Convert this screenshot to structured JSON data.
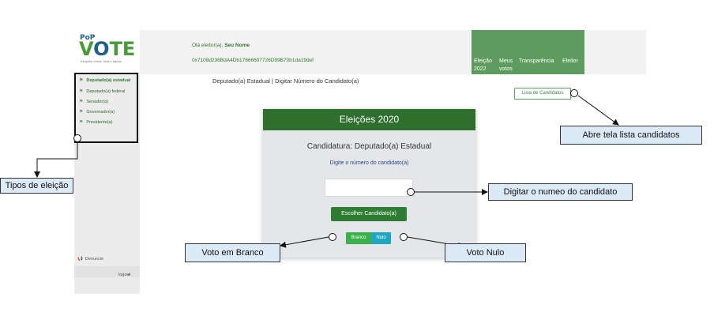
{
  "logo": {
    "pop": "PoP",
    "vote_v": "V",
    "vote_o": "O",
    "vote_te": "TE",
    "tagline": "Eleições online, fácil e rápido"
  },
  "sidebar": {
    "items": [
      {
        "label": "Deputado(a) estadual",
        "icon": "flag-icon",
        "active": true
      },
      {
        "label": "Deputado(a) federal",
        "icon": "flag-icon",
        "active": false
      },
      {
        "label": "Senador(a)",
        "icon": "flag-icon",
        "active": false
      },
      {
        "label": "Governador(a)",
        "icon": "flag-icon",
        "active": false
      },
      {
        "label": "Presidente(a)",
        "icon": "flag-icon",
        "active": false
      }
    ],
    "denuncia": "Denuncie",
    "logout": "logout"
  },
  "header": {
    "greeting": "Olá eleitor(a),",
    "user_name": "Seu Nome",
    "address": "0x7108d236BdA4Db1766660772​6D99B70b1da19def",
    "nav": [
      {
        "line1": "Eleição",
        "line2": "2022"
      },
      {
        "line1": "Meus",
        "line2": "votos"
      },
      {
        "line1": "Transparência",
        "line2": ""
      },
      {
        "line1": "Eleitor",
        "line2": ""
      }
    ]
  },
  "breadcrumb": "Deputado(a) Estadual | Digitar Número do Candidato(a)",
  "lista_button": "Lista de Candidatos",
  "card": {
    "title": "Eleições 2020",
    "candidatura": "Candidatura: Deputado(a) Estadual",
    "prompt": "Digite o número do candidato(a)",
    "input_value": "",
    "choose_button": "Escolher Candidato(a)",
    "branco": "Branco",
    "nulo": "Nulo"
  },
  "annotations": {
    "tipos": "Tipos de eleição",
    "lista": "Abre tela lista candidatos",
    "digitar": "Digitar o numeo do candidato",
    "branco": "Voto em Branco",
    "nulo": "Voto Nulo"
  },
  "colors": {
    "brand_green": "#2e6f2e",
    "nav_green": "#5e9b5e",
    "nulo_blue": "#1fa6c0",
    "annotation_bg": "#dce9f7"
  }
}
